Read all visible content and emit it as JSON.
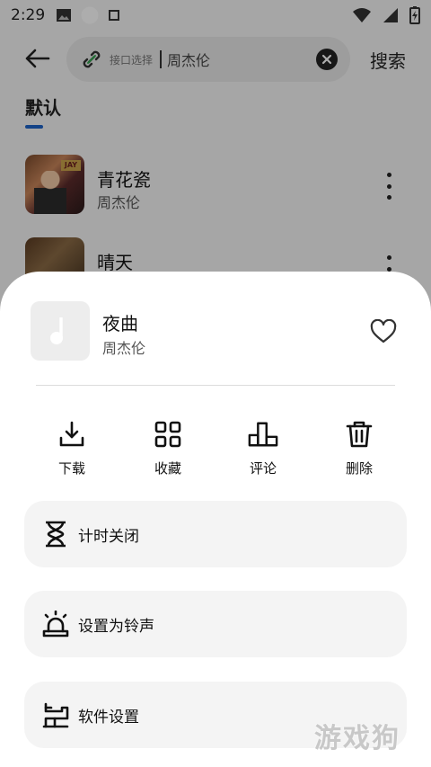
{
  "status_bar": {
    "time": "2:29",
    "left_icons": [
      "image-icon",
      "circle-icon",
      "square-icon"
    ],
    "right_icons": [
      "wifi-icon",
      "signal-icon",
      "battery-charging-icon"
    ]
  },
  "search": {
    "interface_label": "接口选择",
    "value": "周杰伦",
    "button_label": "搜索"
  },
  "tabs": [
    {
      "label": "默认",
      "active": true
    }
  ],
  "songs": [
    {
      "title": "青花瓷",
      "artist": "周杰伦"
    },
    {
      "title": "晴天",
      "artist": ""
    }
  ],
  "sheet": {
    "now_playing": {
      "title": "夜曲",
      "artist": "周杰伦",
      "favorited": false
    },
    "actions": [
      {
        "label": "下载",
        "icon": "download-icon"
      },
      {
        "label": "收藏",
        "icon": "grid-icon"
      },
      {
        "label": "评论",
        "icon": "podium-icon"
      },
      {
        "label": "删除",
        "icon": "trash-icon"
      }
    ],
    "options": [
      {
        "label": "计时关闭",
        "icon": "hourglass-icon"
      },
      {
        "label": "设置为铃声",
        "icon": "alarm-icon"
      },
      {
        "label": "软件设置",
        "icon": "settings-icon"
      }
    ]
  },
  "colors": {
    "accent": "#1e63c8",
    "scrim": "#00000052",
    "sheet_background": "#ffffff",
    "option_background": "#f4f4f4"
  },
  "watermark": "游戏狗"
}
